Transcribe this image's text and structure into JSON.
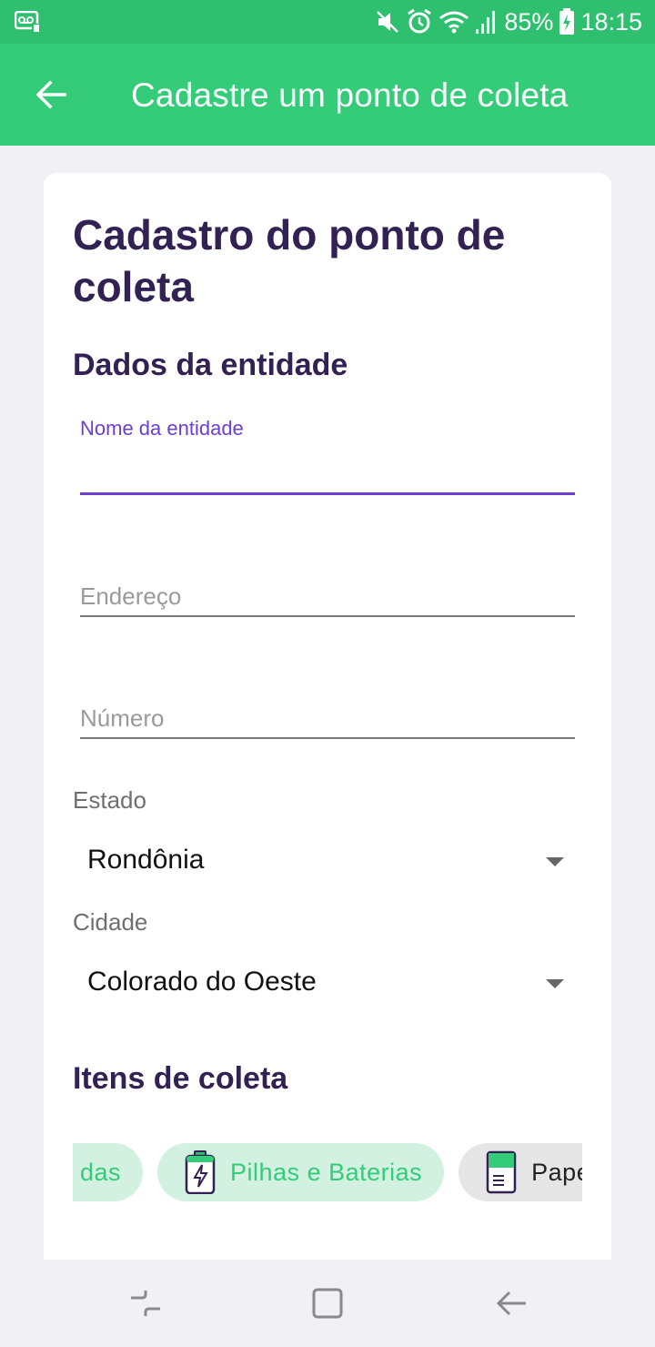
{
  "status_bar": {
    "battery": "85%",
    "time": "18:15",
    "icons": [
      "voicemail-icon",
      "mute-icon",
      "alarm-icon",
      "wifi-icon",
      "signal-icon",
      "battery-icon"
    ]
  },
  "app_bar": {
    "title": "Cadastre um ponto de coleta",
    "back_icon": "arrow-left-icon"
  },
  "form": {
    "title": "Cadastro do ponto de coleta",
    "entity_section": "Dados da entidade",
    "entity_name": {
      "label": "Nome da entidade",
      "value": ""
    },
    "address": {
      "placeholder": "Endereço",
      "value": ""
    },
    "number": {
      "placeholder": "Número",
      "value": ""
    },
    "state": {
      "label": "Estado",
      "value": "Rondônia"
    },
    "city": {
      "label": "Cidade",
      "value": "Colorado do Oeste"
    },
    "items_section": "Itens de coleta",
    "items": [
      {
        "label": "das",
        "selected": true
      },
      {
        "label": "Pilhas e Baterias",
        "selected": true,
        "icon": "battery-icon"
      },
      {
        "label": "Papel",
        "selected": false,
        "icon": "paper-icon"
      }
    ]
  },
  "colors": {
    "primary": "#34CB79",
    "primary_dark": "#2EBF6F",
    "heading": "#322153",
    "accent": "#6C3FCF",
    "chip_selected_bg": "#D2F1E1",
    "chip_unselected_bg": "#E6E6E6"
  },
  "nav_bar": [
    "recents-icon",
    "home-icon",
    "back-icon"
  ]
}
